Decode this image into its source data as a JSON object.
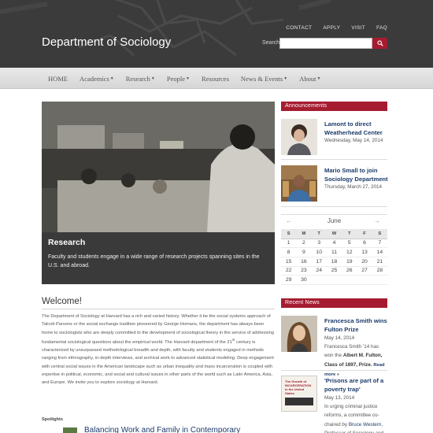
{
  "header": {
    "title": "Department of Sociology",
    "utility_links": [
      "CONTACT",
      "APPLY",
      "VISIT",
      "FAQ"
    ],
    "search_label": "Search",
    "search_placeholder": ""
  },
  "nav": {
    "items": [
      {
        "label": "HOME",
        "dropdown": false
      },
      {
        "label": "Academics",
        "dropdown": true
      },
      {
        "label": "Research",
        "dropdown": true
      },
      {
        "label": "People",
        "dropdown": true
      },
      {
        "label": "Resources",
        "dropdown": false
      },
      {
        "label": "News & Events",
        "dropdown": true
      },
      {
        "label": "About",
        "dropdown": true
      }
    ]
  },
  "hero": {
    "title": "Research",
    "text": "Faculty and students engage in a wide range of research projects spanning sites in the U.S. and abroad."
  },
  "welcome": {
    "title": "Welcome!",
    "text_before_sup": "The Department of Sociology at Harvard has a rich and varied history. Whether it be the social systems approach of Talcott Parsons or the social exchange tradition pioneered by George Homans, the department has always been home to sociologists who are deeply committed to the development of sociological theory in the service of addressing fundamental sociological questions about the empirical world. The Harvard department of the 21",
    "sup": "st",
    "text_after_sup": " century is characterized by unsurpassed methodological breadth and depth, with faculty and students engaged in methods ranging from ethnography, in-depth interviews, and archival work to advanced statistical modeling. Deep engagement with central social issues in the American landscape such as urban inequality and mass incarceration is coupled with expertise in political, economic, and social and cultural issues in other parts of the world such as Latin America, Asia, and Europe. We invite you to explore sociology at Harvard."
  },
  "spotlights": {
    "label": "Spotlights",
    "first_title": "Balancing Work and Family in Contemporary"
  },
  "announcements": {
    "heading": "Announcements",
    "items": [
      {
        "title": "Lamont to direct Weatherhead Center",
        "date": "Wednesday, May 14, 2014"
      },
      {
        "title": "Mario Small to join Sociology Department",
        "date": "Thursday, March 27, 2014"
      }
    ]
  },
  "calendar": {
    "prev_symbol": "←",
    "next_symbol": "→",
    "month": "June",
    "weekdays": [
      "S",
      "M",
      "T",
      "W",
      "T",
      "F",
      "S"
    ],
    "weeks": [
      [
        "1",
        "2",
        "3",
        "4",
        "5",
        "6",
        "7"
      ],
      [
        "8",
        "9",
        "10",
        "11",
        "12",
        "13",
        "14"
      ],
      [
        "15",
        "16",
        "17",
        "18",
        "19",
        "20",
        "21"
      ],
      [
        "22",
        "23",
        "24",
        "25",
        "26",
        "27",
        "28"
      ],
      [
        "29",
        "30",
        "",
        "",
        "",
        "",
        ""
      ]
    ]
  },
  "recent_news": {
    "heading": "Recent News",
    "items": [
      {
        "title": "Francesca Smith wins Fulton Prize",
        "date": "May 14, 2014",
        "summary_start": "Francesca Smith '14 has won the ",
        "summary_bold": "Albert M. Fulton, Class of 1897, Prize.",
        "read_more": "Read more »"
      },
      {
        "title": "'Prisons are part of a poverty trap'",
        "date": "May 13, 2014",
        "summary_start": "In urging criminal justice reforms, a committee co-chaired by ",
        "summary_link": "Bruce Western",
        "summary_end": ", Professor of Sociology and Daniel and Florence",
        "book_cover_title": "The Growth of INCARCERATION in the United States"
      }
    ]
  },
  "colors": {
    "header_bg": "#3b3b3b",
    "accent_red": "#a51c30",
    "link_blue": "#1b3a6b",
    "nav_bg": "#e0e0e0"
  },
  "icons": {
    "search_button": "search-icon",
    "calendar_prev": "arrow-left-icon",
    "calendar_next": "arrow-right-icon"
  }
}
